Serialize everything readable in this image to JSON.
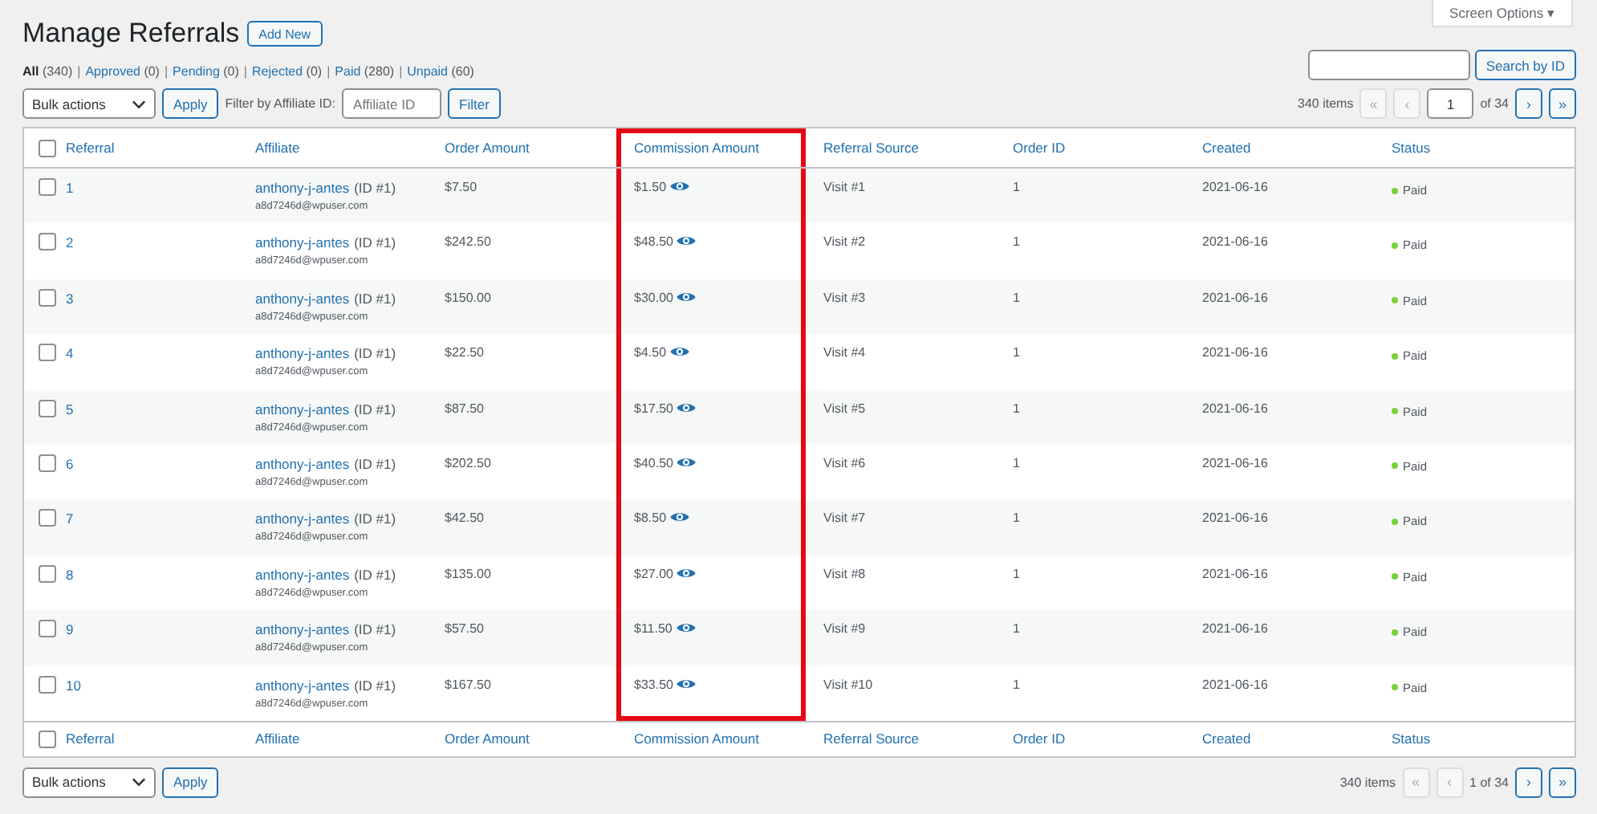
{
  "screen_options": "Screen Options ▾",
  "title": "Manage Referrals",
  "add_new": "Add New",
  "filter_separator": "|",
  "filters": [
    {
      "label": "All",
      "count": "(340)",
      "selected": true
    },
    {
      "label": "Approved",
      "count": "(0)",
      "selected": false
    },
    {
      "label": "Pending",
      "count": "(0)",
      "selected": false
    },
    {
      "label": "Rejected",
      "count": "(0)",
      "selected": false
    },
    {
      "label": "Paid",
      "count": "(280)",
      "selected": false
    },
    {
      "label": "Unpaid",
      "count": "(60)",
      "selected": false
    }
  ],
  "search": {
    "button": "Search by ID"
  },
  "top_controls": {
    "bulk_actions": "Bulk actions",
    "apply": "Apply",
    "filter_label": "Filter by Affiliate ID:",
    "filter_placeholder": "Affiliate ID",
    "filter_button": "Filter"
  },
  "top_pagination": {
    "items": "340 items",
    "page": "1",
    "of": "of 34",
    "buttons": [
      {
        "label": "«",
        "disabled": true
      },
      {
        "label": "‹",
        "disabled": true
      },
      {
        "label": "›",
        "disabled": false
      },
      {
        "label": "»",
        "disabled": false
      }
    ]
  },
  "table": {
    "select_all": {
      "checked": false
    },
    "columns": [
      {
        "label": "Referral",
        "highlighted": false
      },
      {
        "label": "Affiliate",
        "highlighted": false
      },
      {
        "label": "Order Amount",
        "highlighted": false
      },
      {
        "label": "Commission Amount",
        "highlighted": true
      },
      {
        "label": "Referral Source",
        "highlighted": false
      },
      {
        "label": "Order ID",
        "highlighted": false
      },
      {
        "label": "Created",
        "highlighted": false
      },
      {
        "label": "Status",
        "highlighted": false
      }
    ],
    "rows": [
      {
        "checked": false,
        "referral": "1",
        "affiliate": "anthony-j-antes",
        "affiliate_id": "(ID #1)",
        "email": "a8d7246d@wpuser.com",
        "order_amount": "$7.50",
        "commission": "$1.50",
        "source": "Visit #1",
        "order_id": "1",
        "created": "2021-06-16",
        "status": "Paid",
        "color": "#7ad03a"
      },
      {
        "checked": false,
        "referral": "2",
        "affiliate": "anthony-j-antes",
        "affiliate_id": "(ID #1)",
        "email": "a8d7246d@wpuser.com",
        "order_amount": "$242.50",
        "commission": "$48.50",
        "source": "Visit #2",
        "order_id": "1",
        "created": "2021-06-16",
        "status": "Paid",
        "color": "#7ad03a"
      },
      {
        "checked": false,
        "referral": "3",
        "affiliate": "anthony-j-antes",
        "affiliate_id": "(ID #1)",
        "email": "a8d7246d@wpuser.com",
        "order_amount": "$150.00",
        "commission": "$30.00",
        "source": "Visit #3",
        "order_id": "1",
        "created": "2021-06-16",
        "status": "Paid",
        "color": "#7ad03a"
      },
      {
        "checked": false,
        "referral": "4",
        "affiliate": "anthony-j-antes",
        "affiliate_id": "(ID #1)",
        "email": "a8d7246d@wpuser.com",
        "order_amount": "$22.50",
        "commission": "$4.50",
        "source": "Visit #4",
        "order_id": "1",
        "created": "2021-06-16",
        "status": "Paid",
        "color": "#7ad03a"
      },
      {
        "checked": false,
        "referral": "5",
        "affiliate": "anthony-j-antes",
        "affiliate_id": "(ID #1)",
        "email": "a8d7246d@wpuser.com",
        "order_amount": "$87.50",
        "commission": "$17.50",
        "source": "Visit #5",
        "order_id": "1",
        "created": "2021-06-16",
        "status": "Paid",
        "color": "#7ad03a"
      },
      {
        "checked": false,
        "referral": "6",
        "affiliate": "anthony-j-antes",
        "affiliate_id": "(ID #1)",
        "email": "a8d7246d@wpuser.com",
        "order_amount": "$202.50",
        "commission": "$40.50",
        "source": "Visit #6",
        "order_id": "1",
        "created": "2021-06-16",
        "status": "Paid",
        "color": "#7ad03a"
      },
      {
        "checked": false,
        "referral": "7",
        "affiliate": "anthony-j-antes",
        "affiliate_id": "(ID #1)",
        "email": "a8d7246d@wpuser.com",
        "order_amount": "$42.50",
        "commission": "$8.50",
        "source": "Visit #7",
        "order_id": "1",
        "created": "2021-06-16",
        "status": "Paid",
        "color": "#7ad03a"
      },
      {
        "checked": false,
        "referral": "8",
        "affiliate": "anthony-j-antes",
        "affiliate_id": "(ID #1)",
        "email": "a8d7246d@wpuser.com",
        "order_amount": "$135.00",
        "commission": "$27.00",
        "source": "Visit #8",
        "order_id": "1",
        "created": "2021-06-16",
        "status": "Paid",
        "color": "#7ad03a"
      },
      {
        "checked": false,
        "referral": "9",
        "affiliate": "anthony-j-antes",
        "affiliate_id": "(ID #1)",
        "email": "a8d7246d@wpuser.com",
        "order_amount": "$57.50",
        "commission": "$11.50",
        "source": "Visit #9",
        "order_id": "1",
        "created": "2021-06-16",
        "status": "Paid",
        "color": "#7ad03a"
      },
      {
        "checked": false,
        "referral": "10",
        "affiliate": "anthony-j-antes",
        "affiliate_id": "(ID #1)",
        "email": "a8d7246d@wpuser.com",
        "order_amount": "$167.50",
        "commission": "$33.50",
        "source": "Visit #10",
        "order_id": "1",
        "created": "2021-06-16",
        "status": "Paid",
        "color": "#7ad03a"
      }
    ],
    "footer_select_all": {
      "checked": false
    },
    "footer_columns": [
      "Referral",
      "Affiliate",
      "Order Amount",
      "Commission Amount",
      "Referral Source",
      "Order ID",
      "Created",
      "Status"
    ]
  },
  "bottom_controls": {
    "bulk_actions": "Bulk actions",
    "apply": "Apply"
  },
  "bottom_pagination": {
    "items": "340 items",
    "page_text": "1 of 34",
    "buttons": [
      {
        "label": "«",
        "disabled": true
      },
      {
        "label": "‹",
        "disabled": true
      },
      {
        "label": "›",
        "disabled": false
      },
      {
        "label": "»",
        "disabled": false
      }
    ]
  }
}
